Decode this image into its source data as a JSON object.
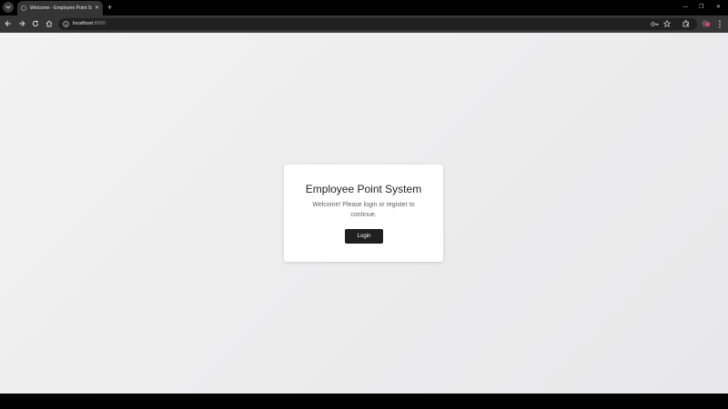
{
  "browser": {
    "tab": {
      "title": "Welcome - Employee Point Sys",
      "close_glyph": "✕"
    },
    "new_tab_glyph": "+",
    "address": {
      "host": "localhost",
      "port": ":8000"
    },
    "window_controls": {
      "minimize": "—",
      "restore": "❐",
      "close": "✕"
    }
  },
  "page": {
    "title": "Employee Point System",
    "message": "Welcome! Please login or register to continue.",
    "login_label": "Login"
  },
  "icons": [
    "tab-menu-icon",
    "globe-icon",
    "back-icon",
    "forward-icon",
    "reload-icon",
    "home-icon",
    "site-info-icon",
    "password-key-icon",
    "bookmark-star-icon",
    "extensions-icon",
    "profile-icon",
    "more-menu-icon"
  ]
}
